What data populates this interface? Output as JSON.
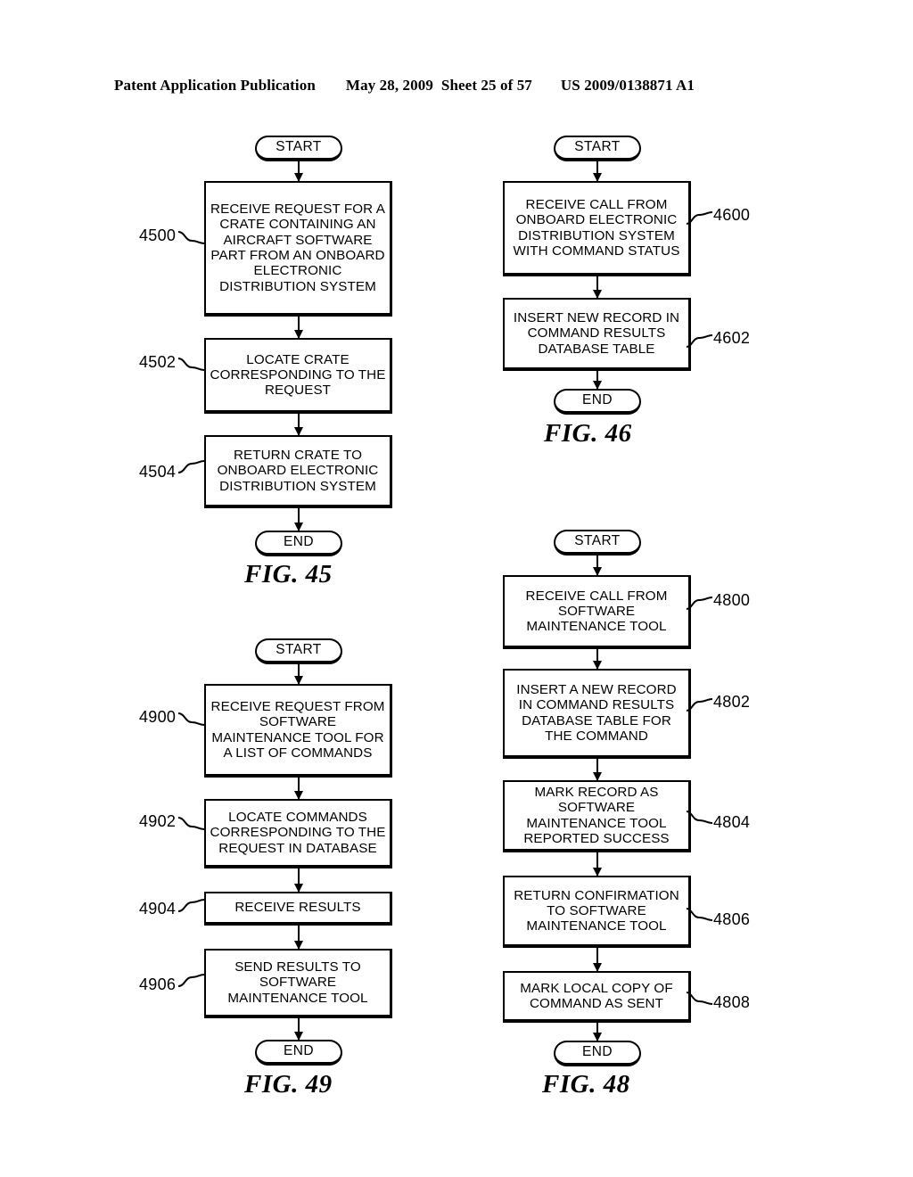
{
  "header": {
    "publication": "Patent Application Publication",
    "date": "May 28, 2009",
    "sheet": "Sheet 25 of 57",
    "patent_number": "US 2009/0138871 A1"
  },
  "figures": [
    {
      "id": "fig45",
      "caption": "FIG. 45",
      "start_label": "START",
      "end_label": "END",
      "steps": [
        {
          "ref": "4500",
          "text": "RECEIVE REQUEST FOR A CRATE CONTAINING AN AIRCRAFT SOFTWARE PART FROM AN ONBOARD ELECTRONIC DISTRIBUTION SYSTEM"
        },
        {
          "ref": "4502",
          "text": "LOCATE CRATE CORRESPONDING TO THE REQUEST"
        },
        {
          "ref": "4504",
          "text": "RETURN CRATE TO ONBOARD ELECTRONIC DISTRIBUTION SYSTEM"
        }
      ]
    },
    {
      "id": "fig46",
      "caption": "FIG. 46",
      "start_label": "START",
      "end_label": "END",
      "steps": [
        {
          "ref": "4600",
          "text": "RECEIVE CALL FROM ONBOARD ELECTRONIC DISTRIBUTION SYSTEM WITH COMMAND STATUS"
        },
        {
          "ref": "4602",
          "text": "INSERT NEW RECORD IN COMMAND RESULTS DATABASE TABLE"
        }
      ]
    },
    {
      "id": "fig49",
      "caption": "FIG. 49",
      "start_label": "START",
      "end_label": "END",
      "steps": [
        {
          "ref": "4900",
          "text": "RECEIVE REQUEST FROM SOFTWARE MAINTENANCE TOOL FOR A LIST OF COMMANDS"
        },
        {
          "ref": "4902",
          "text": "LOCATE COMMANDS CORRESPONDING TO THE REQUEST IN DATABASE"
        },
        {
          "ref": "4904",
          "text": "RECEIVE RESULTS"
        },
        {
          "ref": "4906",
          "text": "SEND RESULTS TO SOFTWARE MAINTENANCE TOOL"
        }
      ]
    },
    {
      "id": "fig48",
      "caption": "FIG. 48",
      "start_label": "START",
      "end_label": "END",
      "steps": [
        {
          "ref": "4800",
          "text": "RECEIVE CALL FROM SOFTWARE MAINTENANCE TOOL"
        },
        {
          "ref": "4802",
          "text": "INSERT A NEW RECORD IN COMMAND RESULTS DATABASE TABLE FOR THE COMMAND"
        },
        {
          "ref": "4804",
          "text": "MARK RECORD AS SOFTWARE MAINTENANCE TOOL REPORTED SUCCESS"
        },
        {
          "ref": "4806",
          "text": "RETURN CONFIRMATION TO SOFTWARE MAINTENANCE TOOL"
        },
        {
          "ref": "4808",
          "text": "MARK LOCAL COPY OF COMMAND AS SENT"
        }
      ]
    }
  ]
}
